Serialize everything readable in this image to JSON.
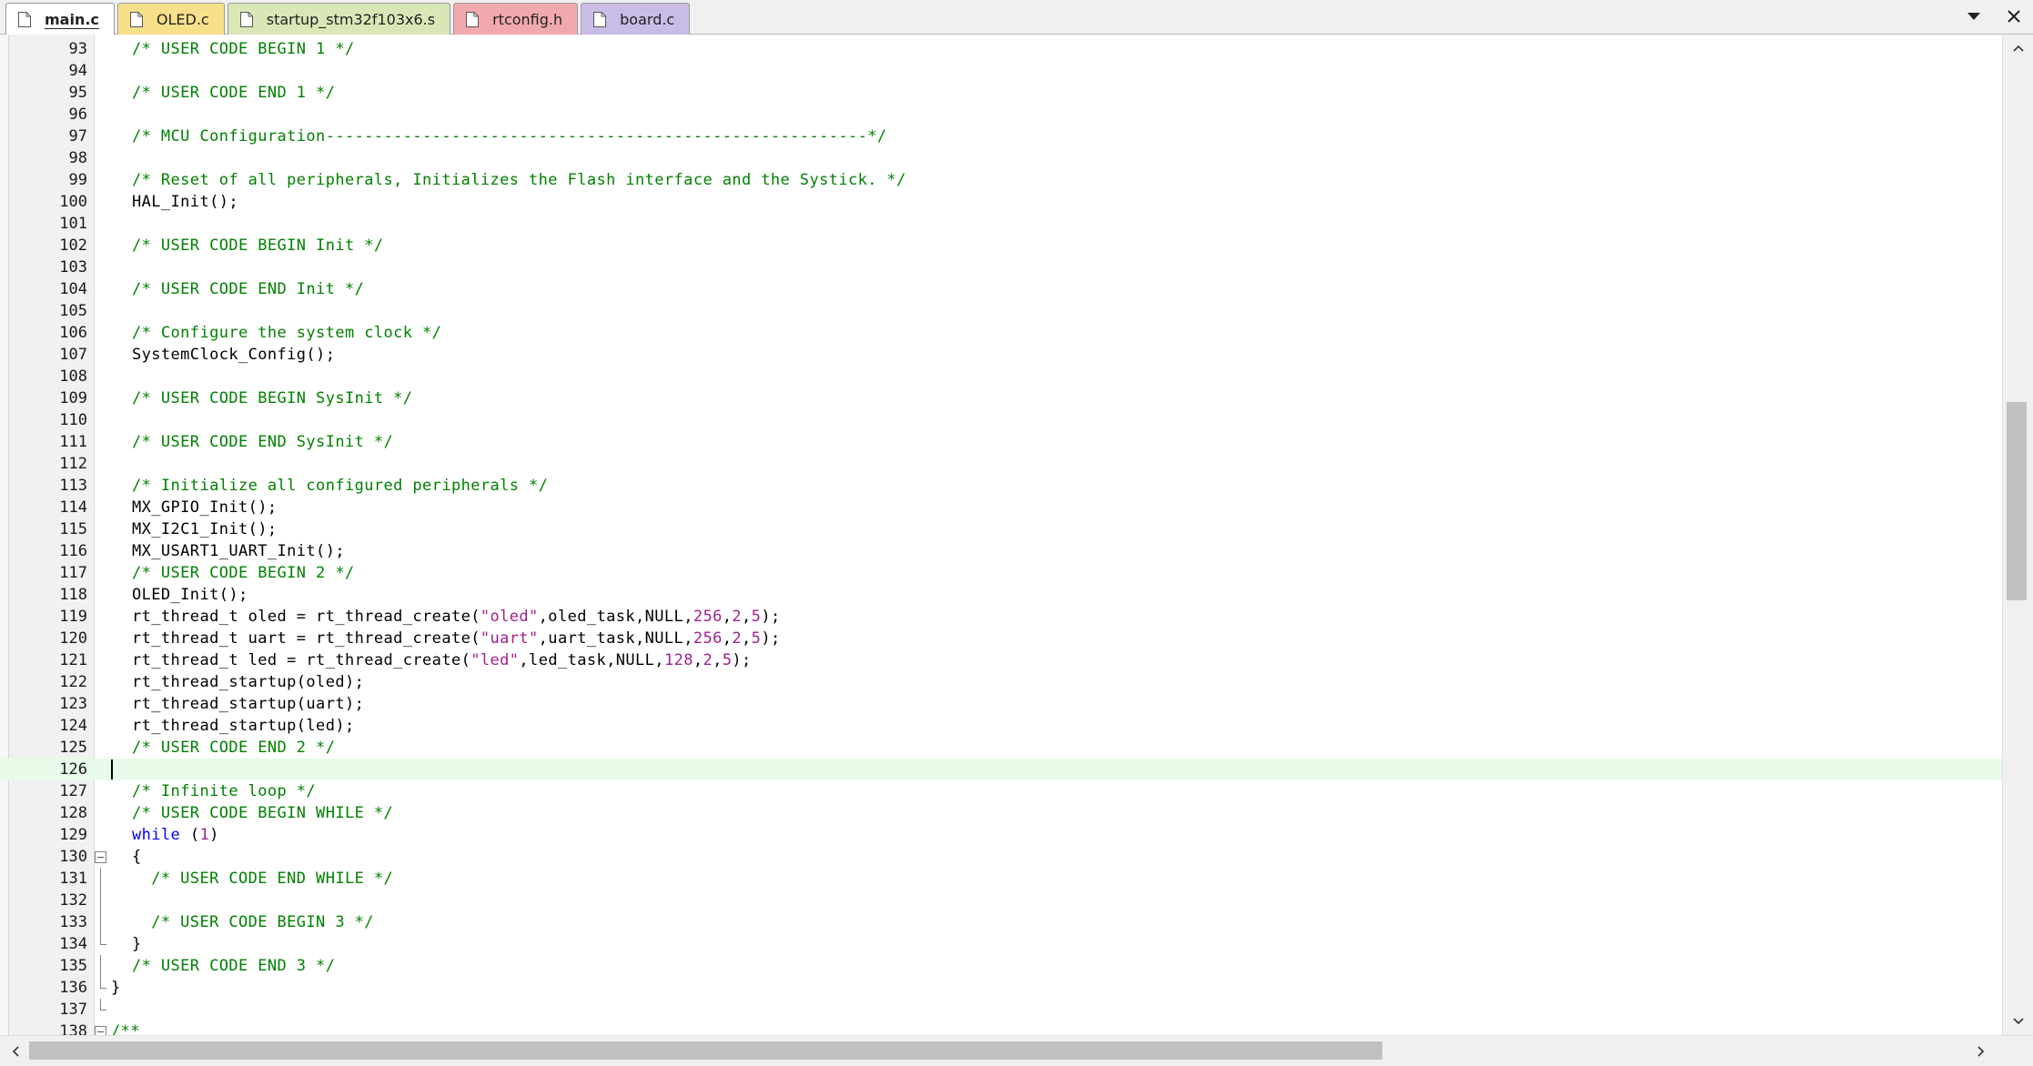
{
  "tabs": [
    {
      "label": "main.c",
      "color": "#ffffff",
      "active": true
    },
    {
      "label": "OLED.c",
      "color": "#f7e08a",
      "active": false
    },
    {
      "label": "startup_stm32f103x6.s",
      "color": "#d9e7b7",
      "active": false
    },
    {
      "label": "rtconfig.h",
      "color": "#f2a9ad",
      "active": false
    },
    {
      "label": "board.c",
      "color": "#c9bde8",
      "active": false
    }
  ],
  "tab_controls": [
    {
      "name": "tab-list-dropdown-icon",
      "glyph": "▼"
    },
    {
      "name": "close-tab-icon",
      "glyph": "✕"
    }
  ],
  "editor": {
    "current_line": 126,
    "lines": [
      {
        "n": 93,
        "tokens": [
          [
            "c",
            "/* USER CODE BEGIN 1 */"
          ]
        ]
      },
      {
        "n": 94,
        "tokens": []
      },
      {
        "n": 95,
        "tokens": [
          [
            "c",
            "/* USER CODE END 1 */"
          ]
        ]
      },
      {
        "n": 96,
        "tokens": []
      },
      {
        "n": 97,
        "tokens": [
          [
            "c",
            "/* MCU Configuration--------------------------------------------------------*/"
          ]
        ]
      },
      {
        "n": 98,
        "tokens": []
      },
      {
        "n": 99,
        "tokens": [
          [
            "c",
            "/* Reset of all peripherals, Initializes the Flash interface and the Systick. */"
          ]
        ]
      },
      {
        "n": 100,
        "tokens": [
          [
            "p",
            "HAL_Init();"
          ]
        ]
      },
      {
        "n": 101,
        "tokens": []
      },
      {
        "n": 102,
        "tokens": [
          [
            "c",
            "/* USER CODE BEGIN Init */"
          ]
        ]
      },
      {
        "n": 103,
        "tokens": []
      },
      {
        "n": 104,
        "tokens": [
          [
            "c",
            "/* USER CODE END Init */"
          ]
        ]
      },
      {
        "n": 105,
        "tokens": []
      },
      {
        "n": 106,
        "tokens": [
          [
            "c",
            "/* Configure the system clock */"
          ]
        ]
      },
      {
        "n": 107,
        "tokens": [
          [
            "p",
            "SystemClock_Config();"
          ]
        ]
      },
      {
        "n": 108,
        "tokens": []
      },
      {
        "n": 109,
        "tokens": [
          [
            "c",
            "/* USER CODE BEGIN SysInit */"
          ]
        ]
      },
      {
        "n": 110,
        "tokens": []
      },
      {
        "n": 111,
        "tokens": [
          [
            "c",
            "/* USER CODE END SysInit */"
          ]
        ]
      },
      {
        "n": 112,
        "tokens": []
      },
      {
        "n": 113,
        "tokens": [
          [
            "c",
            "/* Initialize all configured peripherals */"
          ]
        ]
      },
      {
        "n": 114,
        "tokens": [
          [
            "p",
            "MX_GPIO_Init();"
          ]
        ]
      },
      {
        "n": 115,
        "tokens": [
          [
            "p",
            "MX_I2C1_Init();"
          ]
        ]
      },
      {
        "n": 116,
        "tokens": [
          [
            "p",
            "MX_USART1_UART_Init();"
          ]
        ]
      },
      {
        "n": 117,
        "tokens": [
          [
            "c",
            "/* USER CODE BEGIN 2 */"
          ]
        ]
      },
      {
        "n": 118,
        "tokens": [
          [
            "p",
            "OLED_Init();"
          ]
        ]
      },
      {
        "n": 119,
        "tokens": [
          [
            "p",
            "rt_thread_t oled = rt_thread_create("
          ],
          [
            "s",
            "\"oled\""
          ],
          [
            "p",
            ",oled_task,NULL,"
          ],
          [
            "n",
            "256"
          ],
          [
            "p",
            ","
          ],
          [
            "n",
            "2"
          ],
          [
            "p",
            ","
          ],
          [
            "n",
            "5"
          ],
          [
            "p",
            ");"
          ]
        ]
      },
      {
        "n": 120,
        "tokens": [
          [
            "p",
            "rt_thread_t uart = rt_thread_create("
          ],
          [
            "s",
            "\"uart\""
          ],
          [
            "p",
            ",uart_task,NULL,"
          ],
          [
            "n",
            "256"
          ],
          [
            "p",
            ","
          ],
          [
            "n",
            "2"
          ],
          [
            "p",
            ","
          ],
          [
            "n",
            "5"
          ],
          [
            "p",
            ");"
          ]
        ]
      },
      {
        "n": 121,
        "tokens": [
          [
            "p",
            "rt_thread_t led = rt_thread_create("
          ],
          [
            "s",
            "\"led\""
          ],
          [
            "p",
            ",led_task,NULL,"
          ],
          [
            "n",
            "128"
          ],
          [
            "p",
            ","
          ],
          [
            "n",
            "2"
          ],
          [
            "p",
            ","
          ],
          [
            "n",
            "5"
          ],
          [
            "p",
            ");"
          ]
        ]
      },
      {
        "n": 122,
        "tokens": [
          [
            "p",
            "rt_thread_startup(oled);"
          ]
        ]
      },
      {
        "n": 123,
        "tokens": [
          [
            "p",
            "rt_thread_startup(uart);"
          ]
        ]
      },
      {
        "n": 124,
        "tokens": [
          [
            "p",
            "rt_thread_startup(led);"
          ]
        ]
      },
      {
        "n": 125,
        "tokens": [
          [
            "c",
            "/* USER CODE END 2 */"
          ]
        ]
      },
      {
        "n": 126,
        "tokens": []
      },
      {
        "n": 127,
        "tokens": [
          [
            "c",
            "/* Infinite loop */"
          ]
        ]
      },
      {
        "n": 128,
        "tokens": [
          [
            "c",
            "/* USER CODE BEGIN WHILE */"
          ]
        ]
      },
      {
        "n": 129,
        "tokens": [
          [
            "k",
            "while"
          ],
          [
            "p",
            " ("
          ],
          [
            "n",
            "1"
          ],
          [
            "p",
            ")"
          ]
        ]
      },
      {
        "n": 130,
        "tokens": [
          [
            "p",
            "{"
          ]
        ],
        "fold": "open"
      },
      {
        "n": 131,
        "tokens": [
          [
            "c",
            "  /* USER CODE END WHILE */"
          ]
        ],
        "fold": "line"
      },
      {
        "n": 132,
        "tokens": [],
        "fold": "line"
      },
      {
        "n": 133,
        "tokens": [
          [
            "c",
            "  /* USER CODE BEGIN 3 */"
          ]
        ],
        "fold": "line"
      },
      {
        "n": 134,
        "tokens": [
          [
            "p",
            "}"
          ]
        ],
        "fold": "end"
      },
      {
        "n": 135,
        "tokens": [
          [
            "c",
            "/* USER CODE END 3 */"
          ]
        ],
        "fold": "line-outer"
      },
      {
        "n": 136,
        "tokens": [
          [
            "p",
            "}"
          ]
        ],
        "fold": "end-outer"
      },
      {
        "n": 137,
        "tokens": [],
        "fold": "end-outer-tail"
      },
      {
        "n": 138,
        "tokens": [
          [
            "c",
            "/**"
          ]
        ],
        "fold": "open-outer"
      }
    ]
  },
  "scrollbars": {
    "vertical_position": 0.36,
    "vertical_visible_fraction": 0.21,
    "horizontal_position": 0.0,
    "horizontal_visible_fraction": 0.7
  },
  "colors": {
    "comment": "#008000",
    "keyword": "#0000ff",
    "string": "#a0208f",
    "current_line": "#e8fbe8"
  }
}
